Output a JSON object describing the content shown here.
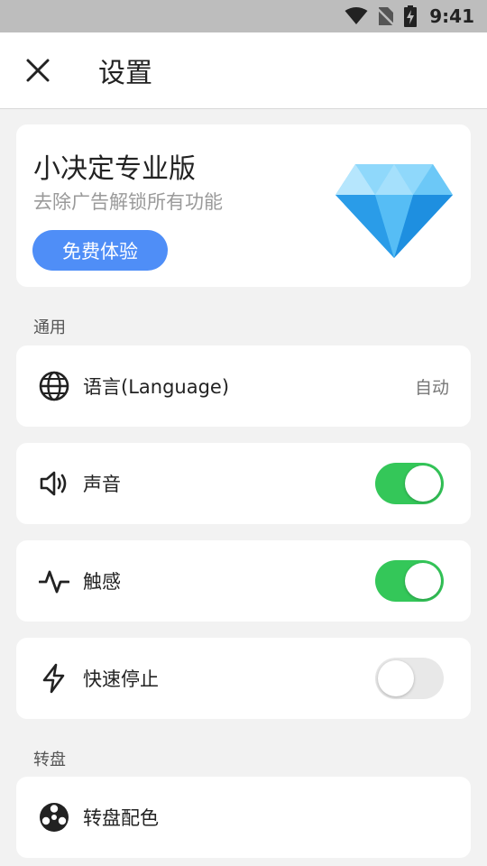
{
  "status_bar": {
    "time": "9:41",
    "icons": [
      "wifi-icon",
      "no-sim-icon",
      "battery-charging-icon"
    ]
  },
  "app_bar": {
    "title": "设置",
    "close_icon": "close-icon"
  },
  "pro_card": {
    "title": "小决定专业版",
    "subtitle": "去除广告解锁所有功能",
    "button_label": "免费体验",
    "image": "diamond-icon",
    "accent_color": "#4f8ef7"
  },
  "sections": {
    "general_label": "通用",
    "wheel_label": "转盘"
  },
  "settings": {
    "language": {
      "label": "语言(Language)",
      "value": "自动",
      "icon": "globe-icon"
    },
    "sound": {
      "label": "声音",
      "icon": "speaker-icon",
      "enabled": true
    },
    "haptics": {
      "label": "触感",
      "icon": "pulse-icon",
      "enabled": true
    },
    "quick_stop": {
      "label": "快速停止",
      "icon": "lightning-icon",
      "enabled": false
    },
    "wheel_colors": {
      "label": "转盘配色",
      "icon": "wheel-icon"
    }
  },
  "colors": {
    "toggle_on": "#34c759",
    "toggle_off": "#e8e8e8"
  }
}
